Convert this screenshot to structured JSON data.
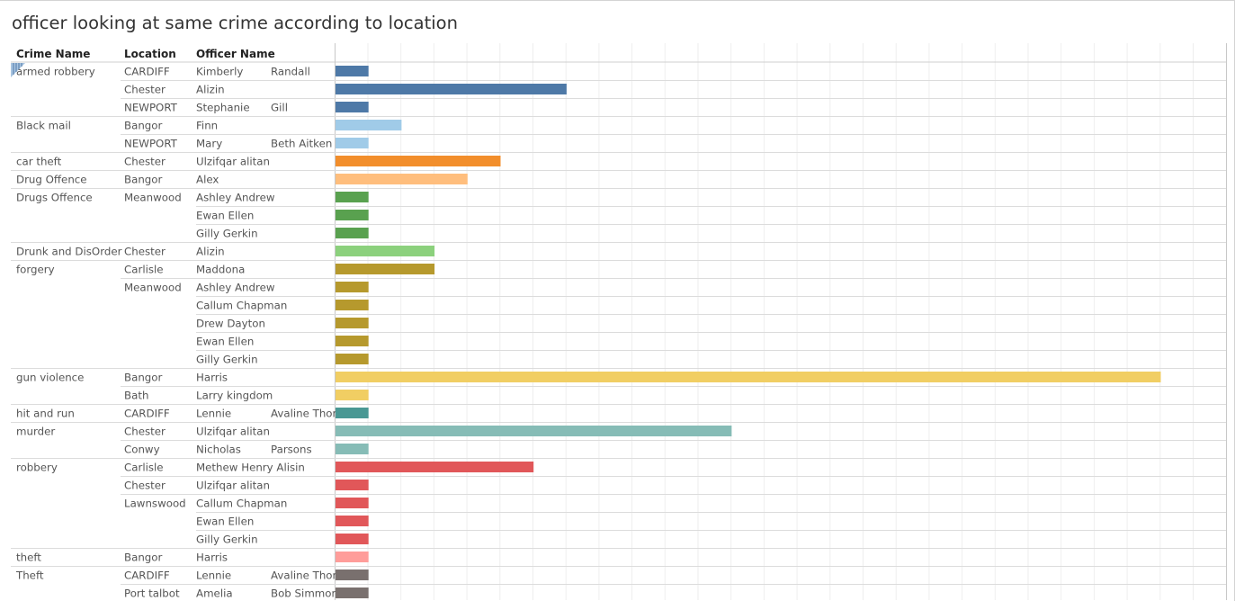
{
  "title": "officer looking at same crime according to location",
  "headers": {
    "crime": "Crime Name",
    "location": "Location",
    "officer": "Officer Name"
  },
  "chart_data": {
    "type": "bar",
    "orientation": "horizontal",
    "title": "officer looking at same crime according to location",
    "grid": true,
    "rows": [
      {
        "crime": "armed robbery",
        "location": "CARDIFF",
        "officer": "Kimberly",
        "officer2": "Randall",
        "value": 1,
        "color": "#4e79a7"
      },
      {
        "crime": "",
        "location": "Chester",
        "officer": "Alizin",
        "officer2": "",
        "value": 7,
        "color": "#4e79a7"
      },
      {
        "crime": "",
        "location": "NEWPORT",
        "officer": "Stephanie",
        "officer2": "Gill",
        "value": 1,
        "color": "#4e79a7"
      },
      {
        "crime": "Black mail",
        "location": "Bangor",
        "officer": "Finn",
        "officer2": "",
        "value": 2,
        "color": "#a0cbe8"
      },
      {
        "crime": "",
        "location": "NEWPORT",
        "officer": "Mary",
        "officer2": "Beth Aitken",
        "value": 1,
        "color": "#a0cbe8"
      },
      {
        "crime": "car theft",
        "location": "Chester",
        "officer": "Ulzifqar alitan",
        "officer2": "",
        "value": 5,
        "color": "#f28e2b"
      },
      {
        "crime": "Drug Offence",
        "location": "Bangor",
        "officer": "Alex",
        "officer2": "",
        "value": 4,
        "color": "#ffbe7d"
      },
      {
        "crime": "Drugs Offence",
        "location": "Meanwood",
        "officer": "Ashley Andrew",
        "officer2": "",
        "value": 1,
        "color": "#59a14f"
      },
      {
        "crime": "",
        "location": "",
        "officer": "Ewan Ellen",
        "officer2": "",
        "value": 1,
        "color": "#59a14f"
      },
      {
        "crime": "",
        "location": "",
        "officer": "Gilly Gerkin",
        "officer2": "",
        "value": 1,
        "color": "#59a14f"
      },
      {
        "crime": "Drunk and DisOrder",
        "location": "Chester",
        "officer": "Alizin",
        "officer2": "",
        "value": 3,
        "color": "#8cd17d"
      },
      {
        "crime": "forgery",
        "location": "Carlisle",
        "officer": "Maddona",
        "officer2": "",
        "value": 3,
        "color": "#b6992d"
      },
      {
        "crime": "",
        "location": "Meanwood",
        "officer": "Ashley Andrew",
        "officer2": "",
        "value": 1,
        "color": "#b6992d"
      },
      {
        "crime": "",
        "location": "",
        "officer": "Callum Chapman",
        "officer2": "",
        "value": 1,
        "color": "#b6992d"
      },
      {
        "crime": "",
        "location": "",
        "officer": "Drew Dayton",
        "officer2": "",
        "value": 1,
        "color": "#b6992d"
      },
      {
        "crime": "",
        "location": "",
        "officer": "Ewan Ellen",
        "officer2": "",
        "value": 1,
        "color": "#b6992d"
      },
      {
        "crime": "",
        "location": "",
        "officer": "Gilly Gerkin",
        "officer2": "",
        "value": 1,
        "color": "#b6992d"
      },
      {
        "crime": "gun violence",
        "location": "Bangor",
        "officer": "Harris",
        "officer2": "",
        "value": 25,
        "color": "#f1ce63"
      },
      {
        "crime": "",
        "location": "Bath",
        "officer": "Larry kingdom",
        "officer2": "",
        "value": 1,
        "color": "#f1ce63"
      },
      {
        "crime": "hit and run",
        "location": "CARDIFF",
        "officer": "Lennie",
        "officer2": "Avaline Thon",
        "value": 1,
        "color": "#499894"
      },
      {
        "crime": "murder",
        "location": "Chester",
        "officer": "Ulzifqar alitan",
        "officer2": "",
        "value": 12,
        "color": "#86bcb6"
      },
      {
        "crime": "",
        "location": "Conwy",
        "officer": "Nicholas",
        "officer2": "Parsons",
        "value": 1,
        "color": "#86bcb6"
      },
      {
        "crime": "robbery",
        "location": "Carlisle",
        "officer": "Methew Henry Alisin",
        "officer2": "",
        "value": 6,
        "color": "#e15759"
      },
      {
        "crime": "",
        "location": "Chester",
        "officer": "Ulzifqar alitan",
        "officer2": "",
        "value": 1,
        "color": "#e15759"
      },
      {
        "crime": "",
        "location": "Lawnswood",
        "officer": "Callum Chapman",
        "officer2": "",
        "value": 1,
        "color": "#e15759"
      },
      {
        "crime": "",
        "location": "",
        "officer": "Ewan Ellen",
        "officer2": "",
        "value": 1,
        "color": "#e15759"
      },
      {
        "crime": "",
        "location": "",
        "officer": "Gilly Gerkin",
        "officer2": "",
        "value": 1,
        "color": "#e15759"
      },
      {
        "crime": "theft",
        "location": "Bangor",
        "officer": "Harris",
        "officer2": "",
        "value": 1,
        "color": "#ff9d9a"
      },
      {
        "crime": "Theft",
        "location": "CARDIFF",
        "officer": "Lennie",
        "officer2": "Avaline Thon",
        "value": 1,
        "color": "#79706e"
      },
      {
        "crime": "",
        "location": "Port talbot",
        "officer": "Amelia",
        "officer2": "Bob Simmon",
        "value": 1,
        "color": "#79706e"
      }
    ]
  }
}
